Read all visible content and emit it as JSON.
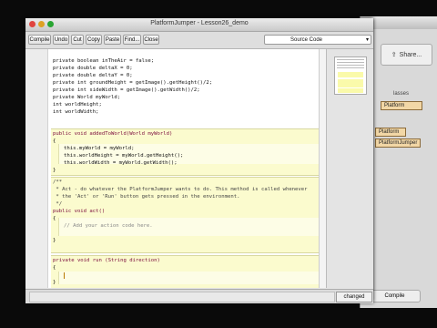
{
  "window": {
    "title": "PlatformJumper - Lesson26_demo"
  },
  "toolbar": {
    "buttons": [
      "Compile",
      "Undo",
      "Cut",
      "Copy",
      "Paste",
      "Find...",
      "Close"
    ],
    "view_select": "Source Code"
  },
  "code": {
    "fields": [
      "private boolean inTheAir = false;",
      "private double deltaX = 0;",
      "private double deltaY = 0;",
      "private int groundHeight = getImage().getHeight()/2;",
      "private int sideWidth = getImage().getWidth()/2;",
      "private World myWorld;",
      "int worldHeight;",
      "int worldWidth;"
    ],
    "added_header": "public void addedToWorld(World myWorld)",
    "open_brace": "{",
    "close_brace": "}",
    "added_body": [
      "this.myWorld = myWorld;",
      "this.worldHeight = myWorld.getHeight();",
      "this.worldWidth = myWorld.getWidth();"
    ],
    "doc_comment": [
      "/**",
      " * Act - do whatever the PlatformJumper wants to do. This method is called whenever",
      " * the 'Act' or 'Run' button gets pressed in the environment.",
      " */"
    ],
    "act_header": "public void act()",
    "act_comment": "// Add your action code here.",
    "run_header": "private void run (String direction)"
  },
  "right_panel": {
    "share_label": "Share...",
    "classes_label": "lasses",
    "class_items": [
      "Platform",
      "Platform",
      "PlatformJumper"
    ],
    "compile_label": "Compile"
  },
  "status": {
    "changed": "changed"
  }
}
